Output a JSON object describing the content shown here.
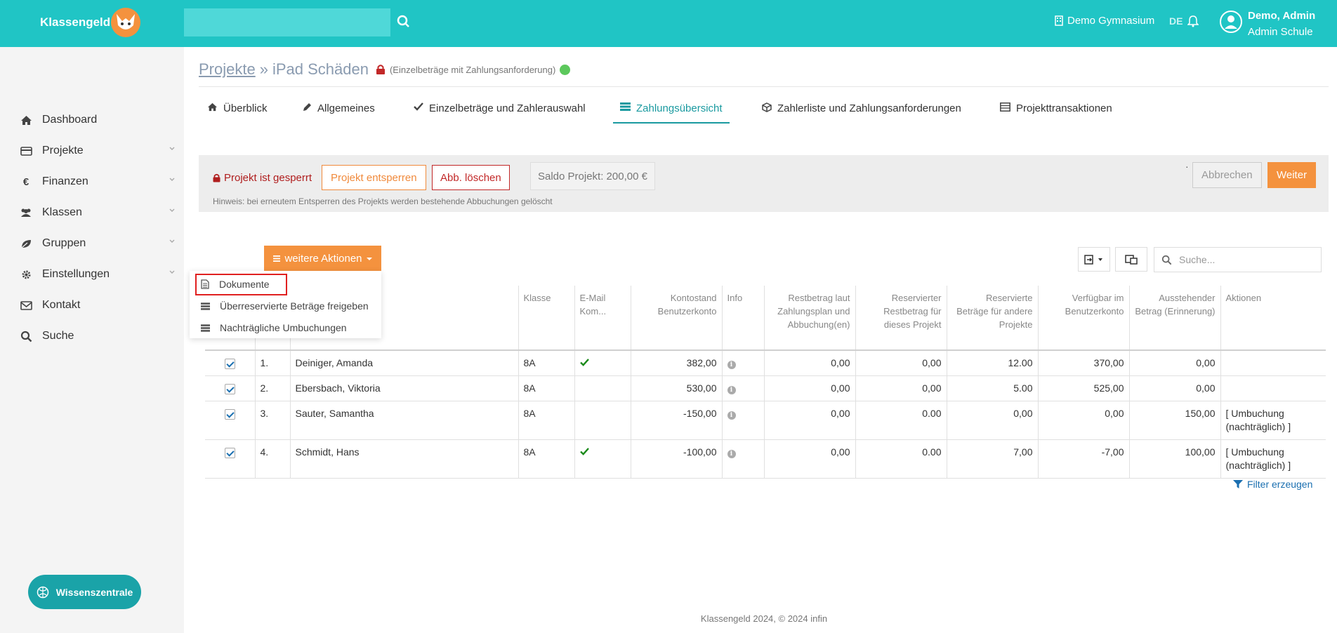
{
  "header": {
    "brand": "Klassengeld",
    "search_placeholder": "",
    "school": "Demo Gymnasium",
    "lang": "DE",
    "user_name": "Demo, Admin",
    "user_school": "Admin Schule",
    "accent": "#20c5c5"
  },
  "sidebar": {
    "items": [
      {
        "label": "Dashboard",
        "icon": "home-icon"
      },
      {
        "label": "Projekte",
        "icon": "card-icon"
      },
      {
        "label": "Finanzen",
        "icon": "euro-icon"
      },
      {
        "label": "Klassen",
        "icon": "users-icon"
      },
      {
        "label": "Gruppen",
        "icon": "leaf-icon"
      },
      {
        "label": "Einstellungen",
        "icon": "gear-icon"
      },
      {
        "label": "Kontakt",
        "icon": "envelope-icon"
      },
      {
        "label": "Suche",
        "icon": "search-icon"
      }
    ],
    "wissen": "Wissenszentrale"
  },
  "breadcrumb": {
    "root": "Projekte",
    "sep": "»",
    "current": "iPad Schäden",
    "sub": "(Einzelbeträge mit Zahlungsanforderung)"
  },
  "tabs": [
    {
      "label": "Überblick"
    },
    {
      "label": "Allgemeines"
    },
    {
      "label": "Einzelbeträge und Zahlerauswahl"
    },
    {
      "label": "Zahlungsübersicht"
    },
    {
      "label": "Zahlerliste und Zahlungsanforderungen"
    },
    {
      "label": "Projekttransaktionen"
    }
  ],
  "lockbar": {
    "locked": "Projekt ist gesperrt",
    "unlock": "Projekt entsperren",
    "delete": "Abb. löschen",
    "saldo": "Saldo Projekt: 200,00 €",
    "hint": "Hinweis: bei erneutem Entsperren des Projekts werden bestehende Abbuchungen gelöscht",
    "cancel": "Abbrechen",
    "next": "Weiter",
    "dot": "·"
  },
  "actions": {
    "button": "weitere Aktionen",
    "menu": [
      "Dokumente",
      "Überreservierte Beträge freigeben",
      "Nachträgliche Umbuchungen"
    ]
  },
  "table": {
    "search_placeholder": "Suche...",
    "headers": {
      "klasse": "Klasse",
      "email": "E-Mail Kom...",
      "kontostand": "Kontostand Benutzerkonto",
      "info": "Info",
      "restbetrag": "Restbetrag laut Zahlungsplan und Abbuchung(en)",
      "reserviert": "Reservierter Restbetrag für dieses Projekt",
      "andere": "Reservierte Beträge für andere Projekte",
      "verfuegbar": "Verfügbar im Benutzerkonto",
      "ausstehend": "Ausstehender Betrag (Erinnerung)",
      "aktionen": "Aktionen"
    },
    "rows": [
      {
        "nr": "1.",
        "name": "Deiniger, Amanda",
        "klasse": "8A",
        "email": true,
        "kontostand": "382,00",
        "rest": "0,00",
        "res": "0,00",
        "andere": "12.00",
        "verf": "370,00",
        "aus": "0,00",
        "aktion": ""
      },
      {
        "nr": "2.",
        "name": "Ebersbach, Viktoria",
        "klasse": "8A",
        "email": false,
        "kontostand": "530,00",
        "rest": "0,00",
        "res": "0,00",
        "andere": "5.00",
        "verf": "525,00",
        "aus": "0,00",
        "aktion": ""
      },
      {
        "nr": "3.",
        "name": "Sauter, Samantha",
        "klasse": "8A",
        "email": false,
        "kontostand": "-150,00",
        "rest": "0,00",
        "res": "0.00",
        "andere": "0,00",
        "verf": "0,00",
        "aus": "150,00",
        "aktion": "[ Umbuchung (nachträglich) ]"
      },
      {
        "nr": "4.",
        "name": "Schmidt, Hans",
        "klasse": "8A",
        "email": true,
        "kontostand": "-100,00",
        "rest": "0,00",
        "res": "0.00",
        "andere": "7,00",
        "verf": "-7,00",
        "aus": "100,00",
        "aktion": "[ Umbuchung (nachträglich) ]"
      }
    ],
    "filter": "Filter erzeugen"
  },
  "footer": "Klassengeld 2024, © 2024 infin"
}
